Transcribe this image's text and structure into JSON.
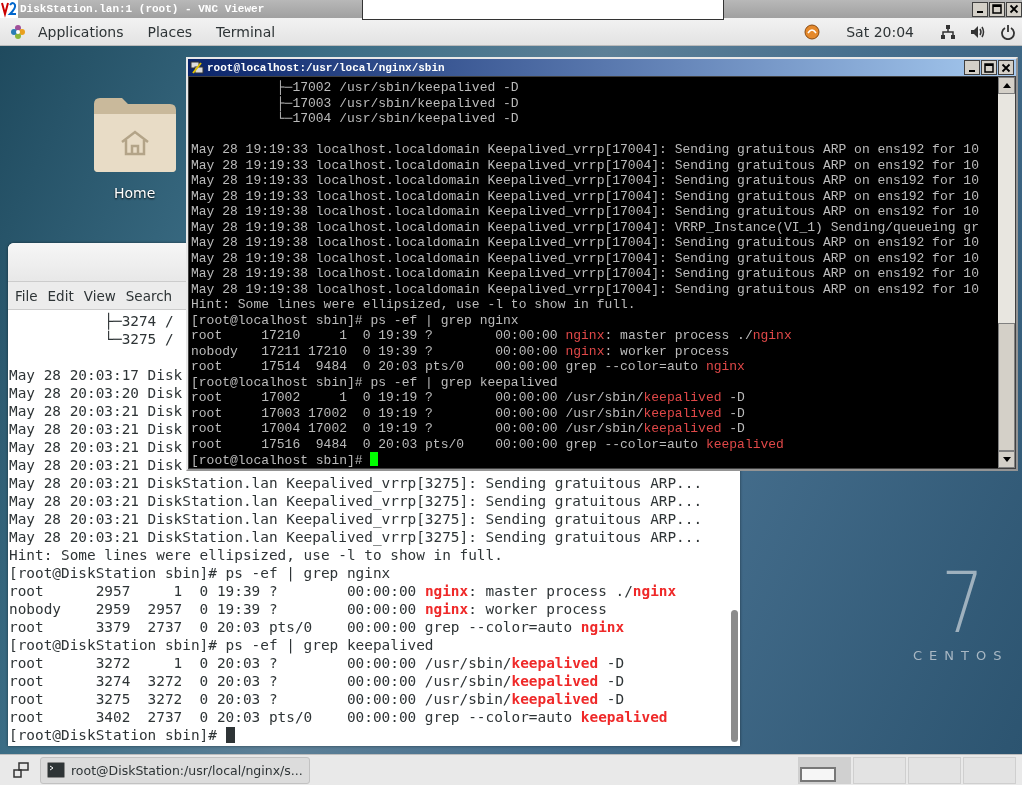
{
  "vnc_window": {
    "title": "DiskStation.lan:1 (root) - VNC Viewer"
  },
  "top_bar": {
    "menus": [
      "Applications",
      "Places",
      "Terminal"
    ],
    "clock": "Sat 20:04"
  },
  "desktop": {
    "icons": [
      {
        "label": "Home"
      }
    ],
    "wallpaper": {
      "version": "7",
      "brand": "CENTOS"
    }
  },
  "local_terminal": {
    "menu": [
      "File",
      "Edit",
      "View",
      "Search"
    ],
    "lines": [
      {
        "kind": "text",
        "text": "           ├─3274 /"
      },
      {
        "kind": "text",
        "text": "           └─3275 /"
      },
      {
        "kind": "blank"
      },
      {
        "kind": "text",
        "text": "May 28 20:03:17 Disk"
      },
      {
        "kind": "text",
        "text": "May 28 20:03:20 Disk"
      },
      {
        "kind": "text",
        "text": "May 28 20:03:21 Disk"
      },
      {
        "kind": "text",
        "text": "May 28 20:03:21 Disk"
      },
      {
        "kind": "text",
        "text": "May 28 20:03:21 Disk"
      },
      {
        "kind": "text",
        "text": "May 28 20:03:21 Disk"
      },
      {
        "kind": "text",
        "text": "May 28 20:03:21 DiskStation.lan Keepalived_vrrp[3275]: Sending gratuitous ARP..."
      },
      {
        "kind": "text",
        "text": "May 28 20:03:21 DiskStation.lan Keepalived_vrrp[3275]: Sending gratuitous ARP..."
      },
      {
        "kind": "text",
        "text": "May 28 20:03:21 DiskStation.lan Keepalived_vrrp[3275]: Sending gratuitous ARP..."
      },
      {
        "kind": "text",
        "text": "May 28 20:03:21 DiskStation.lan Keepalived_vrrp[3275]: Sending gratuitous ARP..."
      },
      {
        "kind": "text",
        "text": "Hint: Some lines were ellipsized, use -l to show in full."
      },
      {
        "kind": "text",
        "text": "[root@DiskStation sbin]# ps -ef | grep nginx"
      },
      {
        "kind": "text",
        "text": "root      2957     1  0 19:39 ?        00:00:00 **nginx**: master process ./**nginx**"
      },
      {
        "kind": "text",
        "text": "nobody    2959  2957  0 19:39 ?        00:00:00 **nginx**: worker process"
      },
      {
        "kind": "text",
        "text": "root      3379  2737  0 20:03 pts/0    00:00:00 grep --color=auto **nginx**"
      },
      {
        "kind": "text",
        "text": "[root@DiskStation sbin]# ps -ef | grep keepalived"
      },
      {
        "kind": "text",
        "text": "root      3272     1  0 20:03 ?        00:00:00 /usr/sbin/**keepalived** -D"
      },
      {
        "kind": "text",
        "text": "root      3274  3272  0 20:03 ?        00:00:00 /usr/sbin/**keepalived** -D"
      },
      {
        "kind": "text",
        "text": "root      3275  3272  0 20:03 ?        00:00:00 /usr/sbin/**keepalived** -D"
      },
      {
        "kind": "text",
        "text": "root      3402  2737  0 20:03 pts/0    00:00:00 grep --color=auto **keepalived**"
      },
      {
        "kind": "prompt",
        "text": "[root@DiskStation sbin]# "
      }
    ]
  },
  "putty": {
    "title": "root@localhost:/usr/local/nginx/sbin",
    "lines": [
      {
        "kind": "text",
        "text": "           ├─17002 /usr/sbin/keepalived -D"
      },
      {
        "kind": "text",
        "text": "           ├─17003 /usr/sbin/keepalived -D"
      },
      {
        "kind": "text",
        "text": "           └─17004 /usr/sbin/keepalived -D"
      },
      {
        "kind": "blank"
      },
      {
        "kind": "text",
        "text": "May 28 19:19:33 localhost.localdomain Keepalived_vrrp[17004]: Sending gratuitous ARP on ens192 for 10"
      },
      {
        "kind": "text",
        "text": "May 28 19:19:33 localhost.localdomain Keepalived_vrrp[17004]: Sending gratuitous ARP on ens192 for 10"
      },
      {
        "kind": "text",
        "text": "May 28 19:19:33 localhost.localdomain Keepalived_vrrp[17004]: Sending gratuitous ARP on ens192 for 10"
      },
      {
        "kind": "text",
        "text": "May 28 19:19:33 localhost.localdomain Keepalived_vrrp[17004]: Sending gratuitous ARP on ens192 for 10"
      },
      {
        "kind": "text",
        "text": "May 28 19:19:38 localhost.localdomain Keepalived_vrrp[17004]: Sending gratuitous ARP on ens192 for 10"
      },
      {
        "kind": "text",
        "text": "May 28 19:19:38 localhost.localdomain Keepalived_vrrp[17004]: VRRP_Instance(VI_1) Sending/queueing gr"
      },
      {
        "kind": "text",
        "text": "May 28 19:19:38 localhost.localdomain Keepalived_vrrp[17004]: Sending gratuitous ARP on ens192 for 10"
      },
      {
        "kind": "text",
        "text": "May 28 19:19:38 localhost.localdomain Keepalived_vrrp[17004]: Sending gratuitous ARP on ens192 for 10"
      },
      {
        "kind": "text",
        "text": "May 28 19:19:38 localhost.localdomain Keepalived_vrrp[17004]: Sending gratuitous ARP on ens192 for 10"
      },
      {
        "kind": "text",
        "text": "May 28 19:19:38 localhost.localdomain Keepalived_vrrp[17004]: Sending gratuitous ARP on ens192 for 10"
      },
      {
        "kind": "text",
        "text": "Hint: Some lines were ellipsized, use -l to show in full."
      },
      {
        "kind": "text",
        "text": "[root@localhost sbin]# ps -ef | grep nginx"
      },
      {
        "kind": "text",
        "text": "root     17210     1  0 19:39 ?        00:00:00 **nginx**: master process ./**nginx**"
      },
      {
        "kind": "text",
        "text": "nobody   17211 17210  0 19:39 ?        00:00:00 **nginx**: worker process"
      },
      {
        "kind": "text",
        "text": "root     17514  9484  0 20:03 pts/0    00:00:00 grep --color=auto **nginx**"
      },
      {
        "kind": "text",
        "text": "[root@localhost sbin]# ps -ef | grep keepalived"
      },
      {
        "kind": "text",
        "text": "root     17002     1  0 19:19 ?        00:00:00 /usr/sbin/**keepalived** -D"
      },
      {
        "kind": "text",
        "text": "root     17003 17002  0 19:19 ?        00:00:00 /usr/sbin/**keepalived** -D"
      },
      {
        "kind": "text",
        "text": "root     17004 17002  0 19:19 ?        00:00:00 /usr/sbin/**keepalived** -D"
      },
      {
        "kind": "text",
        "text": "root     17516  9484  0 20:03 pts/0    00:00:00 grep --color=auto **keepalived**"
      },
      {
        "kind": "prompt",
        "text": "[root@localhost sbin]# "
      }
    ]
  },
  "taskbar": {
    "tasks": [
      {
        "label": "root@DiskStation:/usr/local/nginx/s...",
        "selected": false
      }
    ],
    "workspaces": [
      {
        "selected": true
      },
      {
        "selected": false
      },
      {
        "selected": false
      },
      {
        "selected": false
      }
    ]
  }
}
